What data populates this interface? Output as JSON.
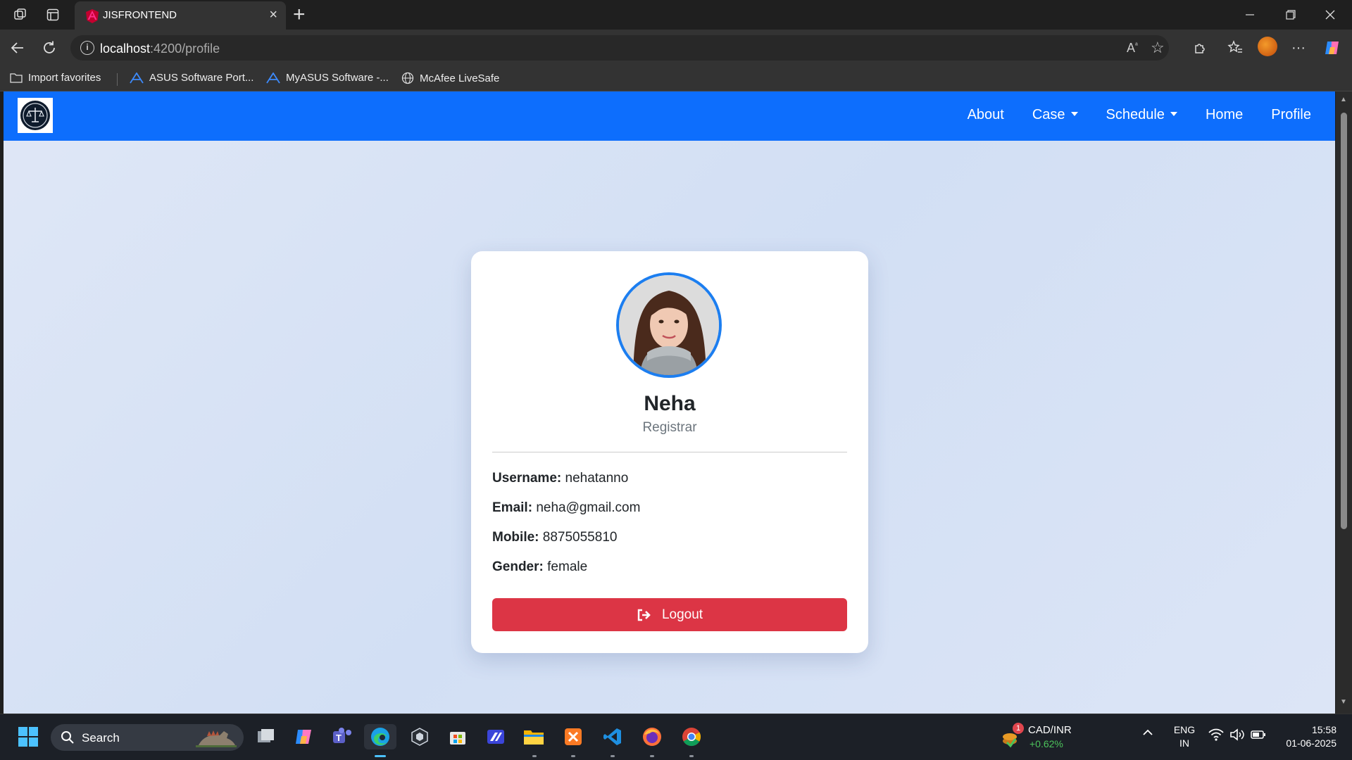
{
  "browser": {
    "tab_title": "JISFRONTEND",
    "url_host": "localhost",
    "url_path": ":4200/profile",
    "bookmarks": [
      "Import favorites",
      "ASUS Software Port...",
      "MyASUS Software -...",
      "McAfee LiveSafe"
    ]
  },
  "app_nav": {
    "links": [
      "About",
      "Case",
      "Schedule",
      "Home",
      "Profile"
    ]
  },
  "profile": {
    "name": "Neha",
    "role": "Registrar",
    "fields": [
      {
        "label": "Username:",
        "value": "nehatanno"
      },
      {
        "label": "Email:",
        "value": "neha@gmail.com"
      },
      {
        "label": "Mobile:",
        "value": "8875055810"
      },
      {
        "label": "Gender:",
        "value": "female"
      }
    ],
    "logout_label": "Logout"
  },
  "taskbar": {
    "search_label": "Search",
    "ticker_name": "CAD/INR",
    "ticker_change": "+0.62%",
    "ticker_badge": "1",
    "lang_top": "ENG",
    "lang_bottom": "IN",
    "time": "15:58",
    "date": "01-06-2025"
  },
  "colors": {
    "nav_blue": "#0d6efd",
    "logout_red": "#dc3545",
    "ticker_green": "#4cc35b"
  }
}
